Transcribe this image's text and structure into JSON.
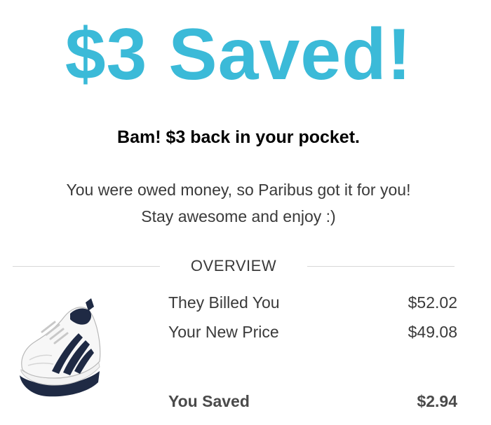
{
  "colors": {
    "accent": "#3bbad8",
    "text": "#3a3a3a"
  },
  "headline": "$3 Saved!",
  "subhead": "Bam! $3 back in your pocket.",
  "message": {
    "line1": "You were owed money, so Paribus got it for you!",
    "line2": "Stay awesome and enjoy :)"
  },
  "overview": {
    "label": "OVERVIEW",
    "product_image": "running-shoe-image",
    "rows": [
      {
        "label": "They Billed You",
        "value": "$52.02"
      },
      {
        "label": "Your New Price",
        "value": "$49.08"
      },
      {
        "label": "You Saved",
        "value": "$2.94"
      }
    ]
  }
}
